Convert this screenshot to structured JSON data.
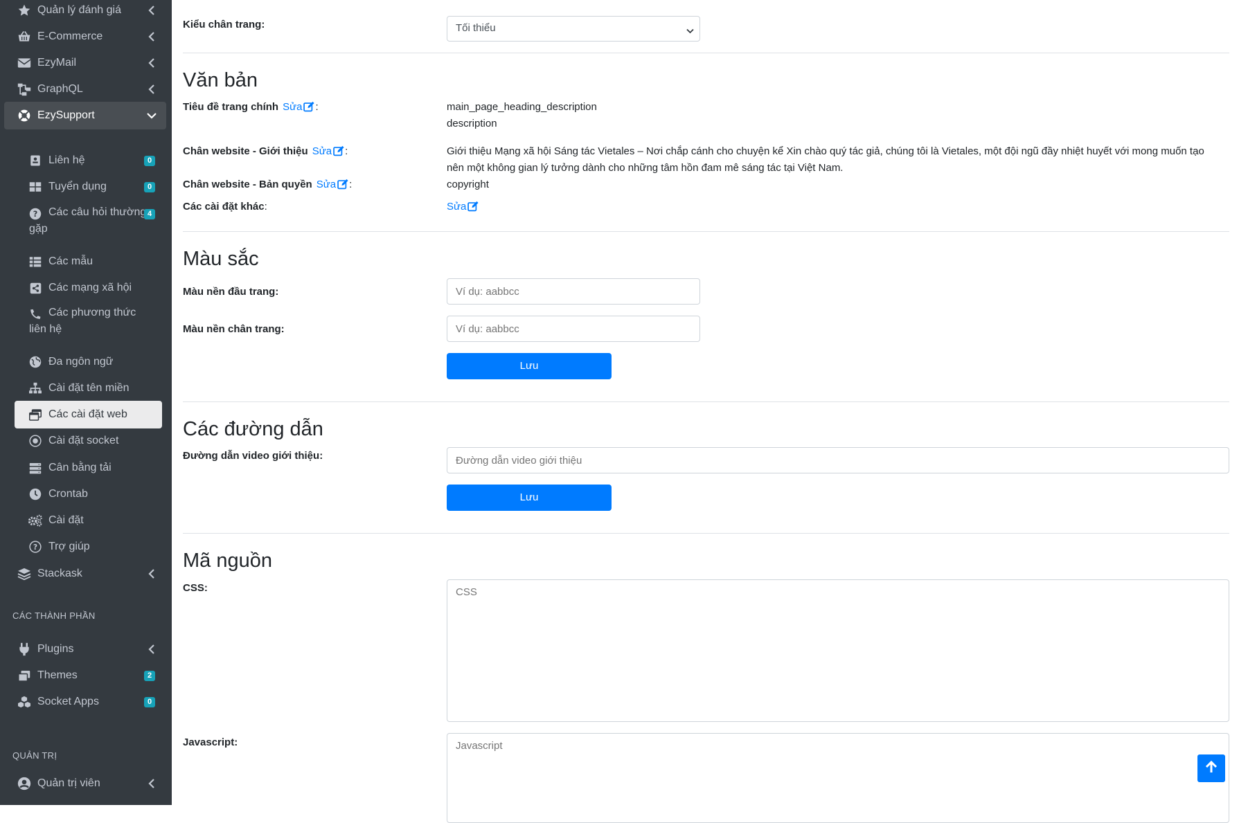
{
  "sidebar": {
    "items": [
      {
        "label": "Quản lý đánh giá",
        "icon": "star-icon"
      },
      {
        "label": "E-Commerce",
        "icon": "shopping-basket-icon"
      },
      {
        "label": "EzyMail",
        "icon": "envelope-icon"
      },
      {
        "label": "GraphQL",
        "icon": "project-diagram-icon"
      },
      {
        "label": "EzySupport",
        "icon": "life-ring-icon"
      }
    ],
    "children": [
      {
        "label": "Liên hệ",
        "icon": "contact-icon",
        "badge": "0"
      },
      {
        "label": "Tuyển dụng",
        "icon": "grid-icon",
        "badge": "0"
      },
      {
        "label": "Các câu hỏi thường gặp",
        "icon": "question-circle-icon",
        "badge": "4"
      },
      {
        "label": "Các mẫu",
        "icon": "table-list-icon"
      },
      {
        "label": "Các mạng xã hội",
        "icon": "share-icon"
      },
      {
        "label": "Các phương thức liên hệ",
        "icon": "phone-icon"
      },
      {
        "label": "Đa ngôn ngữ",
        "icon": "globe-icon"
      },
      {
        "label": "Cài đặt tên miền",
        "icon": "sitemap-icon"
      },
      {
        "label": "Các cài đặt web",
        "icon": "window-icon"
      },
      {
        "label": "Cài đặt socket",
        "icon": "socket-icon"
      },
      {
        "label": "Cân bằng tải",
        "icon": "server-icon"
      },
      {
        "label": "Crontab",
        "icon": "clock-icon"
      },
      {
        "label": "Cài đặt",
        "icon": "cogs-icon"
      },
      {
        "label": "Trợ giúp",
        "icon": "help-circle-icon"
      }
    ],
    "stackask": {
      "label": "Stackask",
      "icon": "layers-icon"
    },
    "components_header": "CÁC THÀNH PHẦN",
    "plugins": {
      "label": "Plugins",
      "icon": "plug-icon"
    },
    "themes": {
      "label": "Themes",
      "icon": "themes-icon",
      "badge": "2"
    },
    "socket_apps": {
      "label": "Socket Apps",
      "icon": "cubes-icon",
      "badge": "0"
    },
    "admin_header": "QUẢN TRỊ",
    "admins": {
      "label": "Quản trị viên",
      "icon": "user-circle-icon"
    }
  },
  "footer_style": {
    "label": "Kiểu chân trang:",
    "selected": "Tối thiểu"
  },
  "text_section": {
    "title": "Văn bản",
    "edit_label": "Sửa",
    "rows": [
      {
        "label": "Tiêu đề trang chính",
        "value_line1": "main_page_heading_description",
        "value_line2": "description"
      },
      {
        "label": "Chân website - Giới thiệu",
        "value": "Giới thiệu Mạng xã hội Sáng tác Vietales – Nơi chắp cánh cho chuyện kể Xin chào quý tác giả, chúng tôi là Vietales, một đội ngũ đầy nhiệt huyết với mong muốn tạo nên một không gian lý tưởng dành cho những tâm hồn đam mê sáng tác tại Việt Nam."
      },
      {
        "label": "Chân website - Bản quyền",
        "value": "copyright"
      }
    ],
    "other_settings_label": "Các cài đặt khác"
  },
  "color_section": {
    "title": "Màu sắc",
    "header_bg_label": "Màu nền đầu trang:",
    "footer_bg_label": "Màu nền chân trang:",
    "placeholder": "Ví dụ: aabbcc",
    "save_label": "Lưu"
  },
  "links_section": {
    "title": "Các đường dẫn",
    "video_label": "Đường dẫn video giới thiệu:",
    "video_placeholder": "Đường dẫn video giới thiệu",
    "save_label": "Lưu"
  },
  "source_section": {
    "title": "Mã nguồn",
    "css_label": "CSS:",
    "css_placeholder": "CSS",
    "js_label": "Javascript:",
    "js_placeholder": "Javascript"
  },
  "colors": {
    "sidebar_bg": "#343a40",
    "accent": "#007bff",
    "badge": "#17a2b8"
  }
}
